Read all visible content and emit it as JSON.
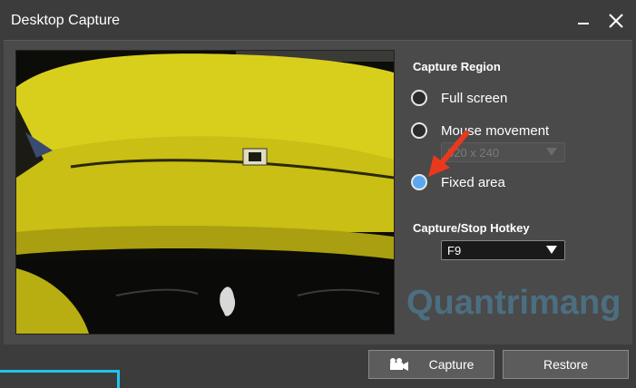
{
  "window": {
    "title": "Desktop Capture"
  },
  "capture_region": {
    "heading": "Capture Region",
    "options": [
      {
        "label": "Full screen",
        "checked": false
      },
      {
        "label": "Mouse movement",
        "checked": false
      },
      {
        "label": "Fixed area",
        "checked": true
      }
    ],
    "mouse_size_select": {
      "value": "320 x 240",
      "disabled": true
    }
  },
  "hotkey": {
    "heading": "Capture/Stop Hotkey",
    "value": "F9"
  },
  "buttons": {
    "capture": "Capture",
    "restore": "Restore"
  },
  "watermark": "Quantrimang",
  "colors": {
    "accent_cyan": "#1fc4ee",
    "radio_checked": "#5aa8f0",
    "annotation_arrow": "#e8391d"
  }
}
